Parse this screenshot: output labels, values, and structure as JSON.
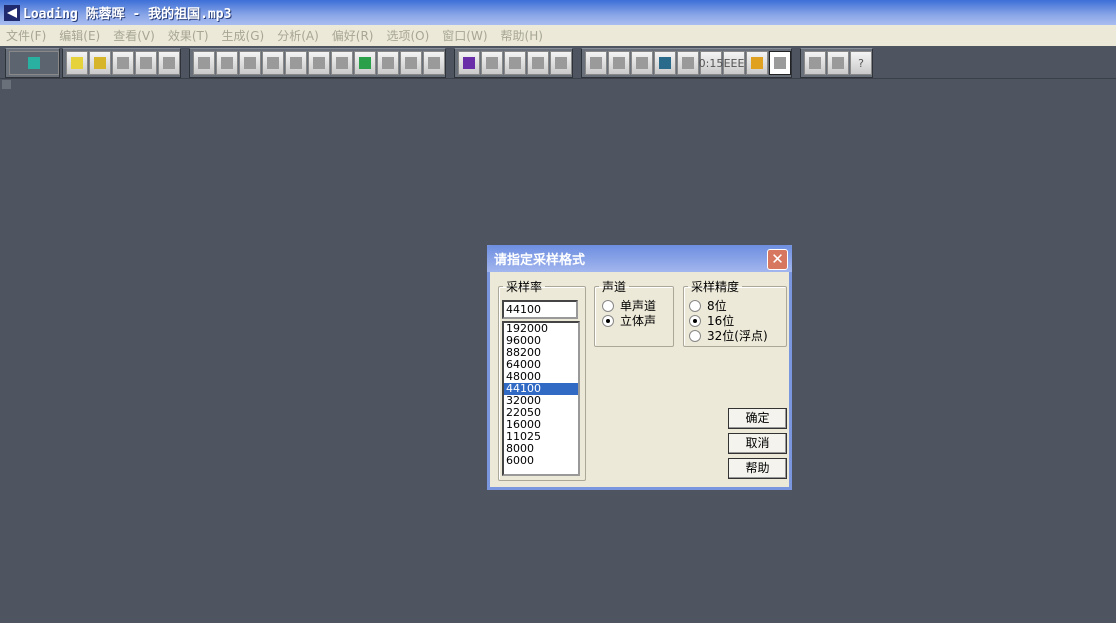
{
  "window": {
    "title": "Loading 陈蓉晖 - 我的祖国.mp3"
  },
  "menu": [
    "文件(F)",
    "编辑(E)",
    "查看(V)",
    "效果(T)",
    "生成(G)",
    "分析(A)",
    "偏好(R)",
    "选项(O)",
    "窗口(W)",
    "帮助(H)"
  ],
  "toolbar": {
    "groups": [
      [
        "session-icon"
      ],
      [
        "new-icon",
        "open-icon",
        "save-icon",
        "save-as-icon",
        "save-all-icon"
      ],
      [
        "undo-icon",
        "redo-icon",
        "repeat-icon",
        "copy-new-icon",
        "copy-icon",
        "cut-icon",
        "paste-icon",
        "paste-new-icon",
        "mix-paste-icon",
        "trim-icon",
        "goto-icon"
      ],
      [
        "spectral-view-icon",
        "check-icon",
        "grid1-icon",
        "grid2-icon",
        "grid3-icon"
      ],
      [
        "window1-icon",
        "window2-icon",
        "window3-icon",
        "play-icon",
        "zoom-icon",
        "time-icon",
        "eee-icon",
        "level-meter-icon",
        "blank-window-icon"
      ],
      [
        "settings-icon",
        "script-icon",
        "help-icon"
      ]
    ],
    "time_label": "0:15",
    "eee_label": "EEE",
    "help_glyph": "?"
  },
  "dialog": {
    "title": "请指定采样格式",
    "sample_rate": {
      "legend": "采样率",
      "value": "44100",
      "options": [
        "192000",
        "96000",
        "88200",
        "64000",
        "48000",
        "44100",
        "32000",
        "22050",
        "16000",
        "11025",
        "8000",
        "6000"
      ],
      "selected": "44100"
    },
    "channels": {
      "legend": "声道",
      "options": [
        "单声道",
        "立体声"
      ],
      "selected": "立体声"
    },
    "resolution": {
      "legend": "采样精度",
      "options": [
        "8位",
        "16位",
        "32位(浮点)"
      ],
      "selected": "16位"
    },
    "buttons": {
      "ok": "确定",
      "cancel": "取消",
      "help": "帮助"
    }
  }
}
